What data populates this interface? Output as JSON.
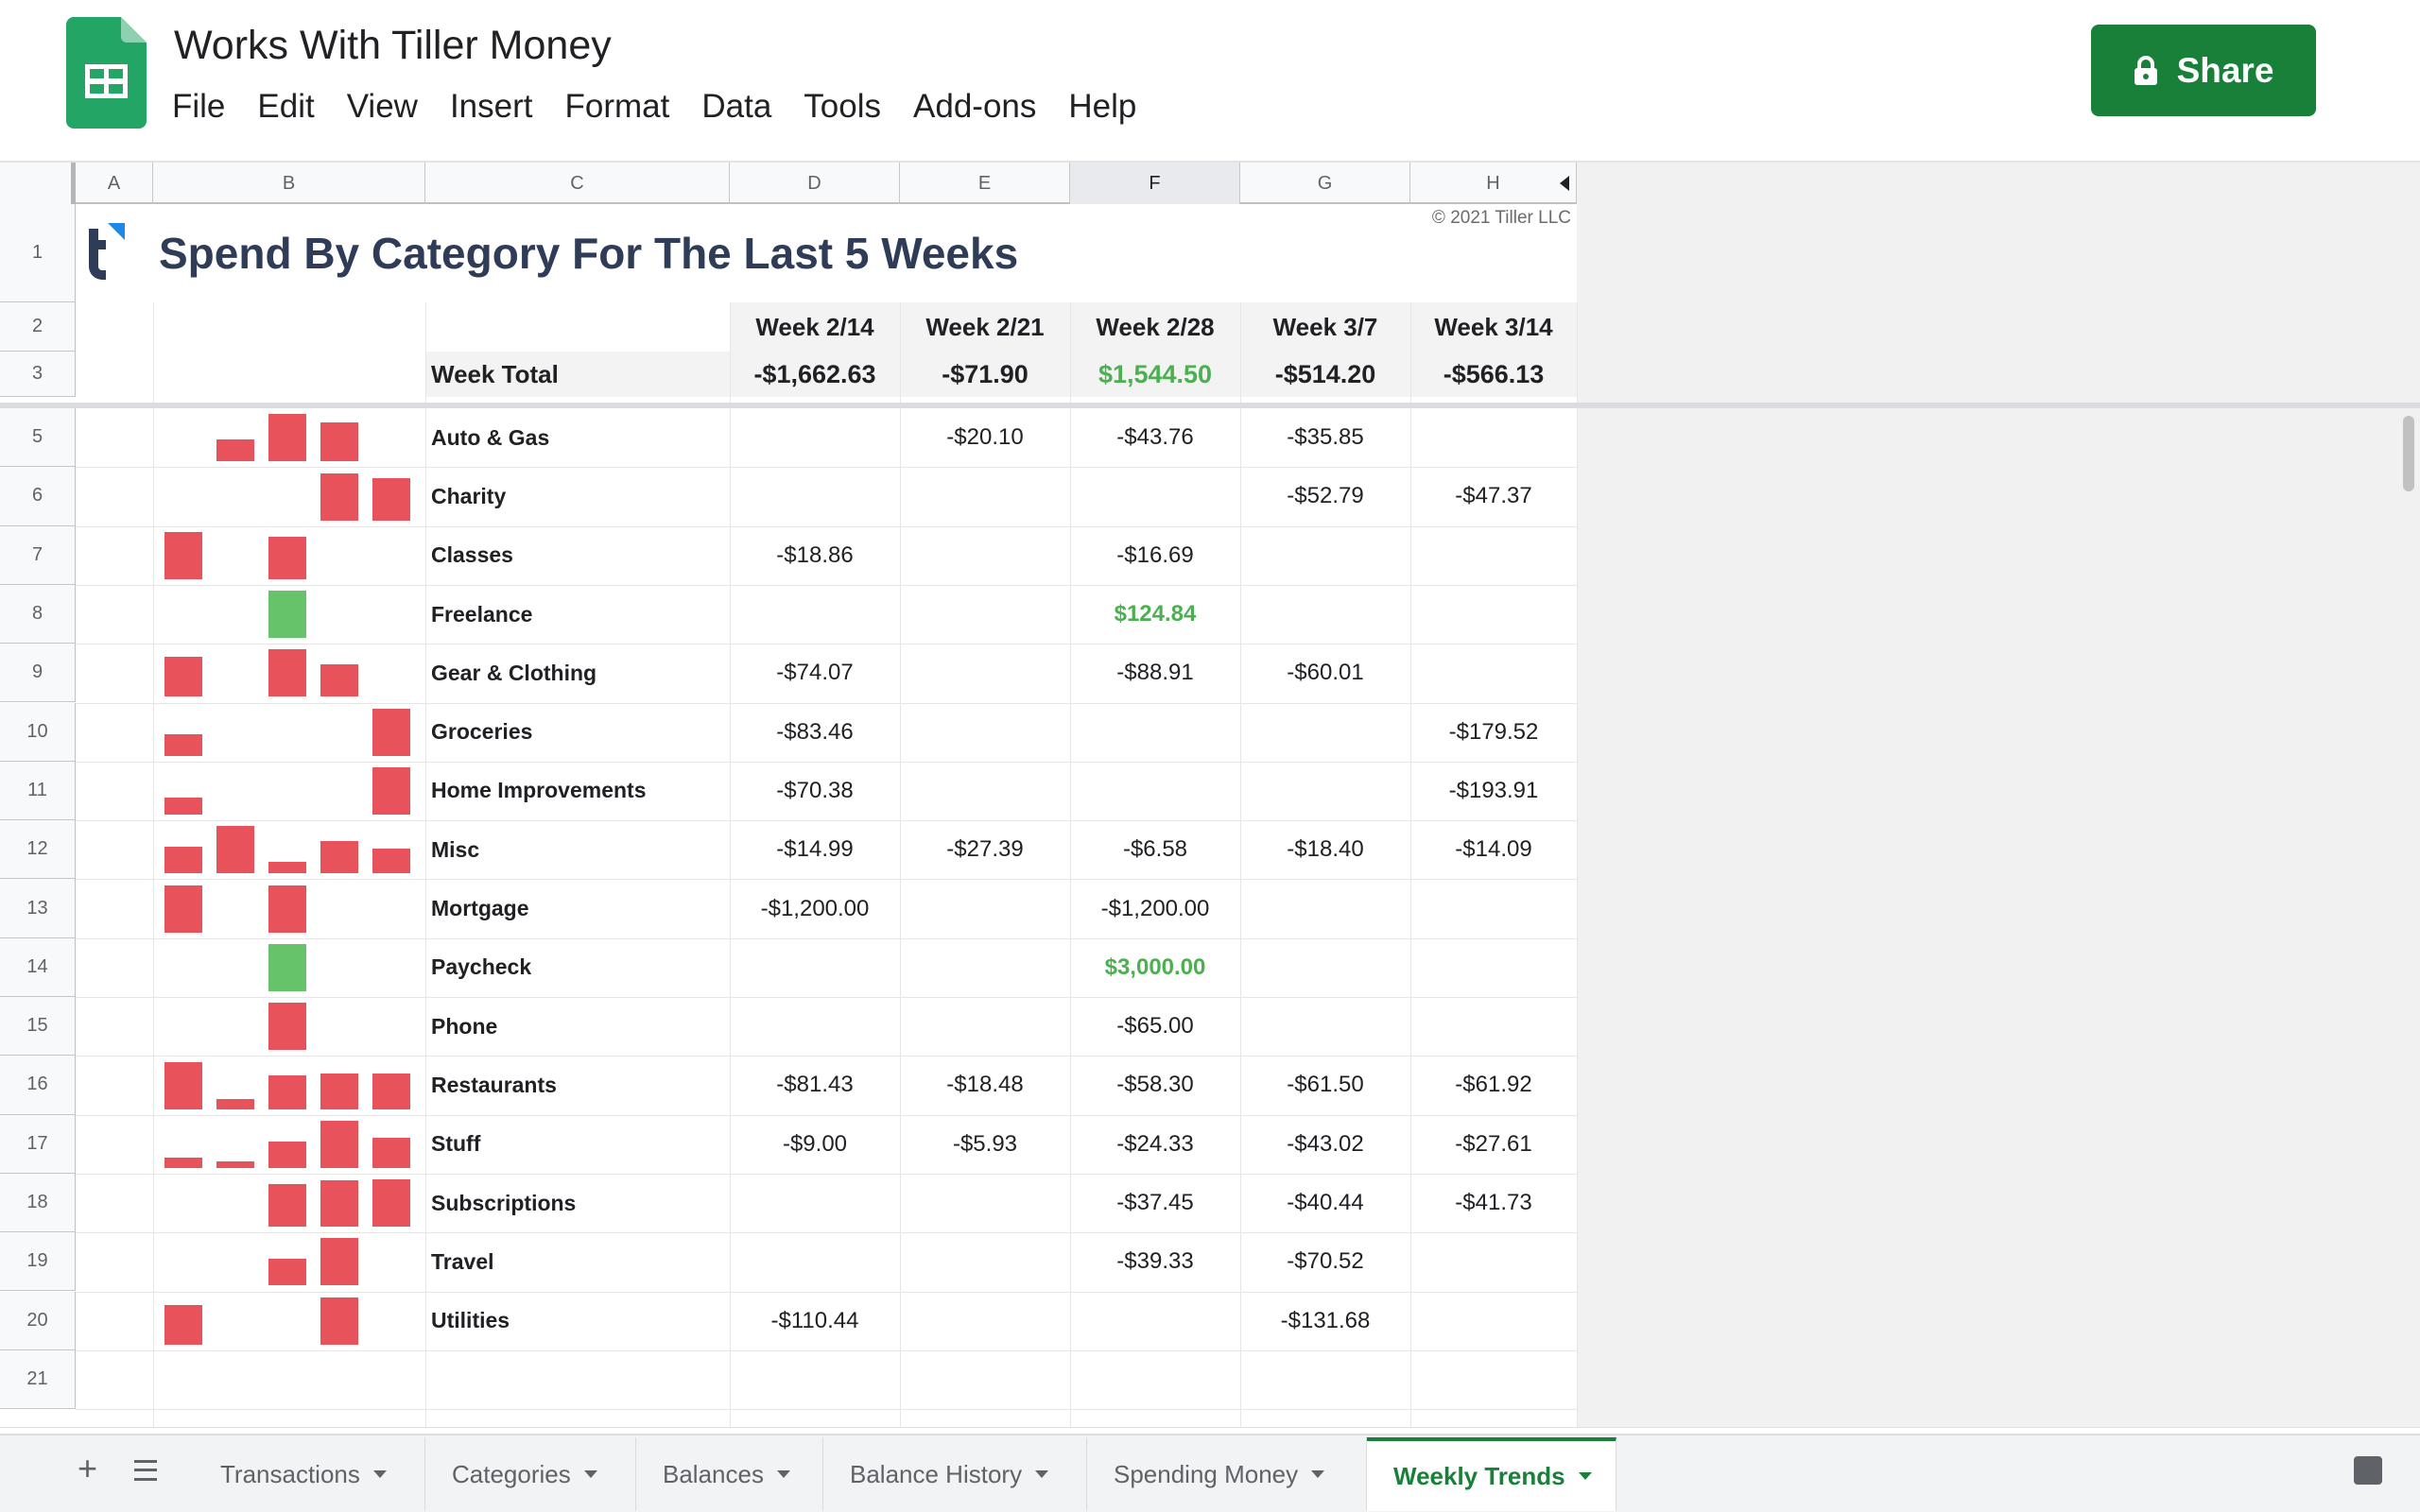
{
  "app": {
    "title": "Works With Tiller Money",
    "menu": [
      "File",
      "Edit",
      "View",
      "Insert",
      "Format",
      "Data",
      "Tools",
      "Add-ons",
      "Help"
    ],
    "share_label": "Share"
  },
  "columns": [
    "A",
    "B",
    "C",
    "D",
    "E",
    "F",
    "G",
    "H"
  ],
  "sheet": {
    "heading": "Spend By Category For The Last 5 Weeks",
    "copyright": "© 2021 Tiller LLC",
    "weeks": [
      "Week 2/14",
      "Week 2/21",
      "Week 2/28",
      "Week 3/7",
      "Week 3/14"
    ],
    "week_total_label": "Week Total",
    "week_totals": [
      "-$1,662.63",
      "-$71.90",
      "$1,544.50",
      "-$514.20",
      "-$566.13"
    ],
    "rows": [
      {
        "num": "5",
        "category": "Auto & Gas",
        "values": [
          "",
          "-$20.10",
          "-$43.76",
          "-$35.85",
          ""
        ],
        "spark": [
          0,
          20.1,
          43.76,
          35.85,
          0
        ]
      },
      {
        "num": "6",
        "category": "Charity",
        "values": [
          "",
          "",
          "",
          "-$52.79",
          "-$47.37"
        ],
        "spark": [
          0,
          0,
          0,
          52.79,
          47.37
        ]
      },
      {
        "num": "7",
        "category": "Classes",
        "values": [
          "-$18.86",
          "",
          "-$16.69",
          "",
          ""
        ],
        "spark": [
          18.86,
          0,
          16.69,
          0,
          0
        ]
      },
      {
        "num": "8",
        "category": "Freelance",
        "values": [
          "",
          "",
          "$124.84",
          "",
          ""
        ],
        "spark": [
          0,
          0,
          124.84,
          0,
          0
        ],
        "income": true
      },
      {
        "num": "9",
        "category": "Gear & Clothing",
        "values": [
          "-$74.07",
          "",
          "-$88.91",
          "-$60.01",
          ""
        ],
        "spark": [
          74.07,
          0,
          88.91,
          60.01,
          0
        ]
      },
      {
        "num": "10",
        "category": "Groceries",
        "values": [
          "-$83.46",
          "",
          "",
          "",
          "-$179.52"
        ],
        "spark": [
          83.46,
          0,
          0,
          0,
          179.52
        ]
      },
      {
        "num": "11",
        "category": "Home Improvements",
        "values": [
          "-$70.38",
          "",
          "",
          "",
          "-$193.91"
        ],
        "spark": [
          70.38,
          0,
          0,
          0,
          193.91
        ]
      },
      {
        "num": "12",
        "category": "Misc",
        "values": [
          "-$14.99",
          "-$27.39",
          "-$6.58",
          "-$18.40",
          "-$14.09"
        ],
        "spark": [
          14.99,
          27.39,
          6.58,
          18.4,
          14.09
        ]
      },
      {
        "num": "13",
        "category": "Mortgage",
        "values": [
          "-$1,200.00",
          "",
          "-$1,200.00",
          "",
          ""
        ],
        "spark": [
          1200,
          0,
          1200,
          0,
          0
        ]
      },
      {
        "num": "14",
        "category": "Paycheck",
        "values": [
          "",
          "",
          "$3,000.00",
          "",
          ""
        ],
        "spark": [
          0,
          0,
          3000,
          0,
          0
        ],
        "income": true
      },
      {
        "num": "15",
        "category": "Phone",
        "values": [
          "",
          "",
          "-$65.00",
          "",
          ""
        ],
        "spark": [
          0,
          0,
          65,
          0,
          0
        ]
      },
      {
        "num": "16",
        "category": "Restaurants",
        "values": [
          "-$81.43",
          "-$18.48",
          "-$58.30",
          "-$61.50",
          "-$61.92"
        ],
        "spark": [
          81.43,
          18.48,
          58.3,
          61.5,
          61.92
        ]
      },
      {
        "num": "17",
        "category": "Stuff",
        "values": [
          "-$9.00",
          "-$5.93",
          "-$24.33",
          "-$43.02",
          "-$27.61"
        ],
        "spark": [
          9.0,
          5.93,
          24.33,
          43.02,
          27.61
        ]
      },
      {
        "num": "18",
        "category": "Subscriptions",
        "values": [
          "",
          "",
          "-$37.45",
          "-$40.44",
          "-$41.73"
        ],
        "spark": [
          0,
          0,
          37.45,
          40.44,
          41.73
        ]
      },
      {
        "num": "19",
        "category": "Travel",
        "values": [
          "",
          "",
          "-$39.33",
          "-$70.52",
          ""
        ],
        "spark": [
          0,
          0,
          39.33,
          70.52,
          0
        ]
      },
      {
        "num": "20",
        "category": "Utilities",
        "values": [
          "-$110.44",
          "",
          "",
          "-$131.68",
          ""
        ],
        "spark": [
          110.44,
          0,
          0,
          131.68,
          0
        ]
      }
    ],
    "top_row_nums": [
      "1",
      "2",
      "3"
    ],
    "empty_row_num": "21"
  },
  "tabs": [
    {
      "label": "Transactions"
    },
    {
      "label": "Categories"
    },
    {
      "label": "Balances"
    },
    {
      "label": "Balance History"
    },
    {
      "label": "Spending Money"
    },
    {
      "label": "Weekly Trends",
      "active": true
    }
  ],
  "colors": {
    "brand_green": "#188038",
    "spark_red": "#e8525a",
    "spark_green": "#66c36a",
    "income_text": "#4caf50",
    "title_navy": "#2f3c57"
  }
}
